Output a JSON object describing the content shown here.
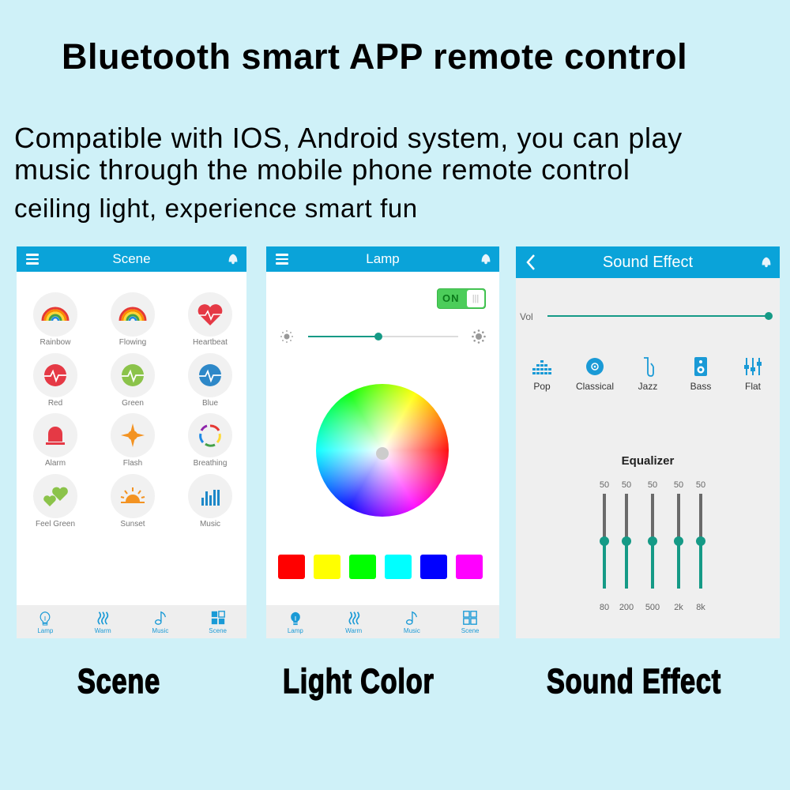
{
  "headline": "Bluetooth smart APP remote control",
  "description": [
    "Compatible with IOS, Android system, you can play",
    "music through the mobile phone remote control",
    "ceiling light, experience smart fun"
  ],
  "colors": {
    "background": "#cff1f8",
    "appbar": "#0aa3d9",
    "accent": "#159a86",
    "toggle_on": "#4ccd5a",
    "tab_icon": "#1a9ad6"
  },
  "scene_screen": {
    "title": "Scene",
    "scenes": [
      {
        "label": "Rainbow",
        "icon": "rainbow-icon"
      },
      {
        "label": "Flowing",
        "icon": "rainbow-icon"
      },
      {
        "label": "Heartbeat",
        "icon": "heartbeat-icon"
      },
      {
        "label": "Red",
        "icon": "pulse-icon"
      },
      {
        "label": "Green",
        "icon": "pulse-icon"
      },
      {
        "label": "Blue",
        "icon": "pulse-icon"
      },
      {
        "label": "Alarm",
        "icon": "alarm-icon"
      },
      {
        "label": "Flash",
        "icon": "flash-icon"
      },
      {
        "label": "Breathing",
        "icon": "breathing-icon"
      },
      {
        "label": "Feel Green",
        "icon": "hearts-icon"
      },
      {
        "label": "Sunset",
        "icon": "sunset-icon"
      },
      {
        "label": "Music",
        "icon": "music-bars-icon"
      }
    ],
    "tabs": [
      "Lamp",
      "Warm",
      "Music",
      "Scene"
    ],
    "active_tab": "Scene"
  },
  "lamp_screen": {
    "title": "Lamp",
    "power_toggle": "ON",
    "brightness_fraction": 0.47,
    "preset_colors": [
      "#ff0000",
      "#ffff00",
      "#00ff00",
      "#00ffff",
      "#0000ff",
      "#ff00ff"
    ],
    "tabs": [
      "Lamp",
      "Warm",
      "Music",
      "Scene"
    ],
    "active_tab": "Lamp"
  },
  "sound_screen": {
    "title": "Sound Effect",
    "volume_label": "Vol",
    "volume_fraction": 1.0,
    "presets": [
      "Pop",
      "Classical",
      "Jazz",
      "Bass",
      "Flat"
    ],
    "equalizer_title": "Equalizer",
    "bands": [
      {
        "freq": "80",
        "value": "50"
      },
      {
        "freq": "200",
        "value": "50"
      },
      {
        "freq": "500",
        "value": "50"
      },
      {
        "freq": "2k",
        "value": "50"
      },
      {
        "freq": "8k",
        "value": "50"
      }
    ],
    "band_max": 100
  },
  "captions": [
    "Scene",
    "Light Color",
    "Sound Effect"
  ]
}
